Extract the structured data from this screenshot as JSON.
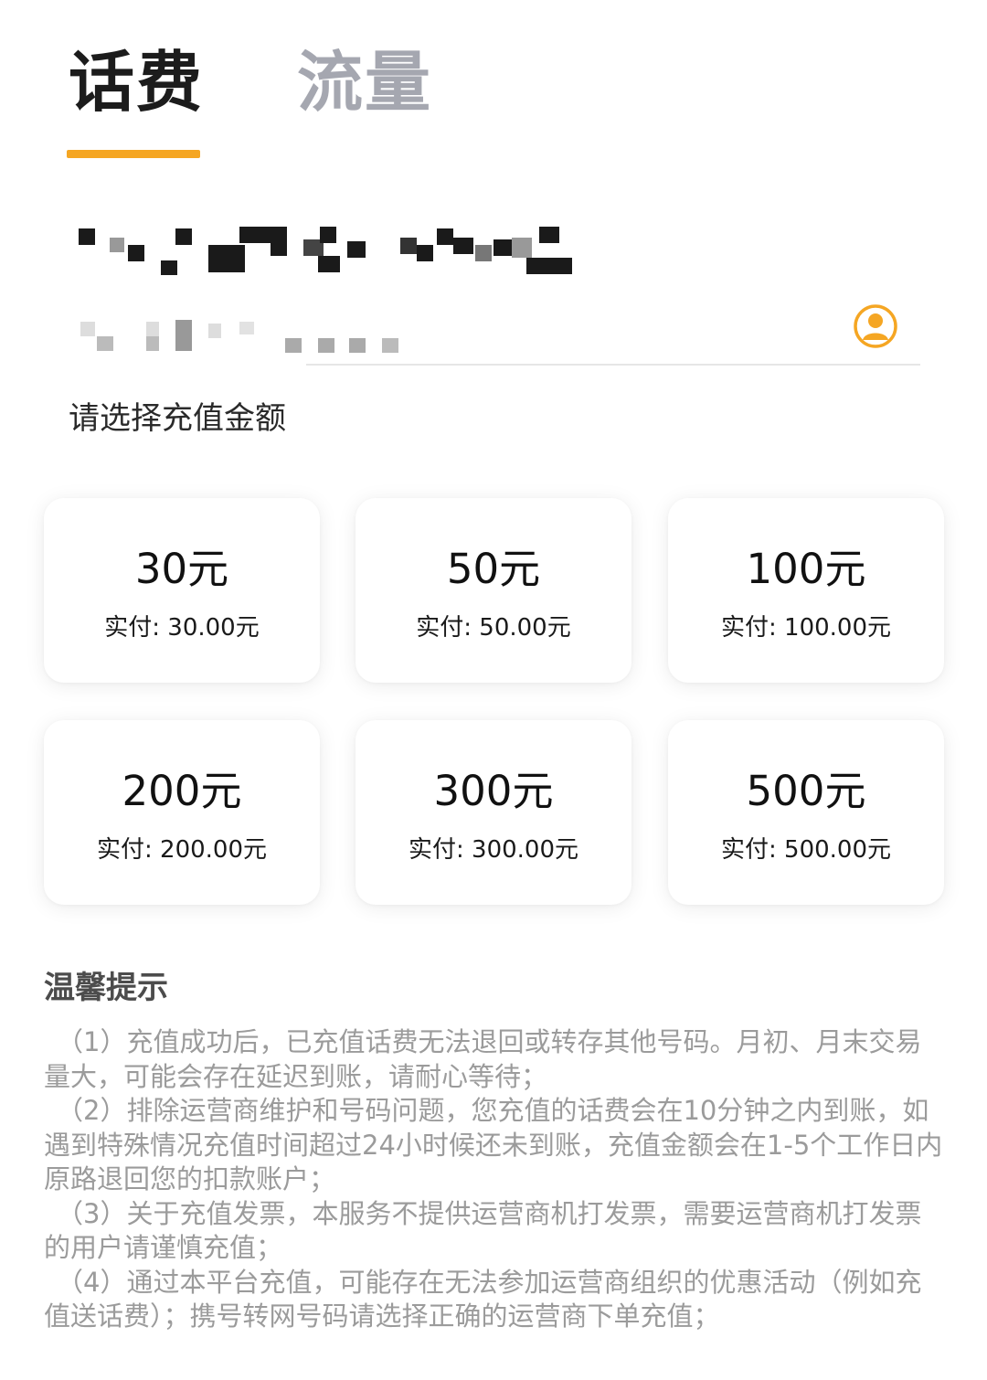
{
  "tabs": [
    {
      "label": "话费",
      "active": true
    },
    {
      "label": "流量",
      "active": false
    }
  ],
  "colors": {
    "accent": "#f5a623",
    "active_tab": "#1c1c1c",
    "inactive_tab": "#a5a7b0",
    "tips_text": "#9b9b9b"
  },
  "phone_field": {
    "icon": "contact-icon"
  },
  "section_label": "请选择充值金额",
  "amounts": [
    {
      "amount": "30元",
      "paid": "实付: 30.00元"
    },
    {
      "amount": "50元",
      "paid": "实付: 50.00元"
    },
    {
      "amount": "100元",
      "paid": "实付: 100.00元"
    },
    {
      "amount": "200元",
      "paid": "实付: 200.00元"
    },
    {
      "amount": "300元",
      "paid": "实付: 300.00元"
    },
    {
      "amount": "500元",
      "paid": "实付: 500.00元"
    }
  ],
  "tips": {
    "title": "温馨提示",
    "items": [
      "（1）充值成功后，已充值话费无法退回或转存其他号码。月初、月末交易量大，可能会存在延迟到账，请耐心等待；",
      "（2）排除运营商维护和号码问题，您充值的话费会在10分钟之内到账，如遇到特殊情况充值时间超过24小时候还未到账，充值金额会在1-5个工作日内原路退回您的扣款账户；",
      "（3）关于充值发票，本服务不提供运营商机打发票，需要运营商机打发票的用户请谨慎充值；",
      "（4）通过本平台充值，可能存在无法参加运营商组织的优惠活动（例如充值送话费）；携号转网号码请选择正确的运营商下单充值；"
    ]
  }
}
